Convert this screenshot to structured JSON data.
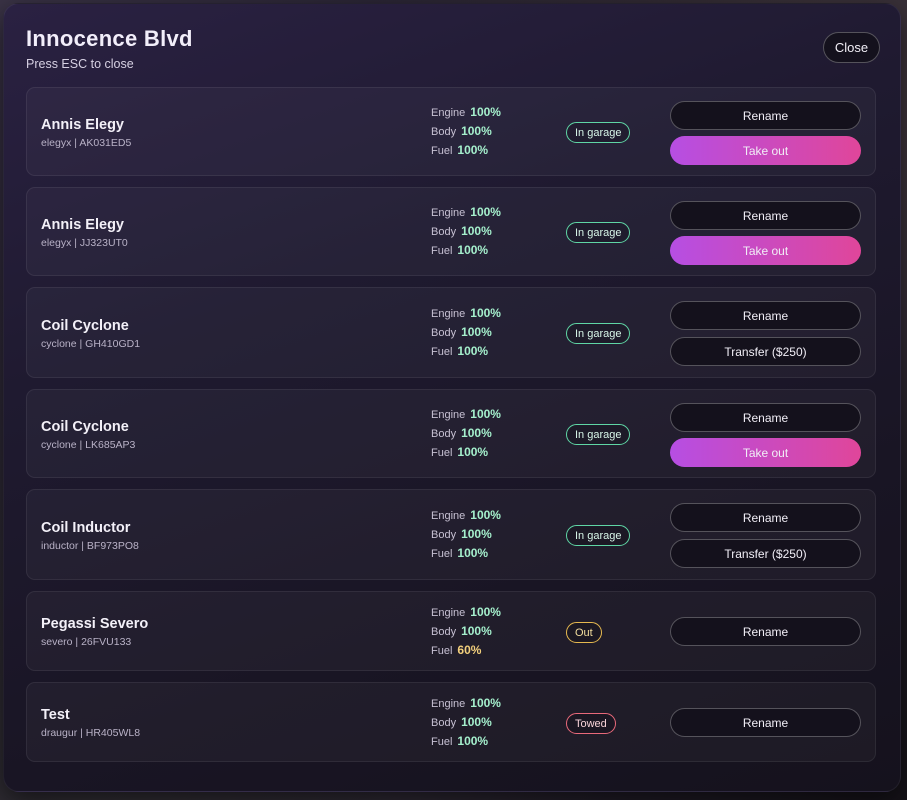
{
  "header": {
    "title": "Innocence Blvd",
    "subtitle": "Press ESC to close",
    "close_label": "Close"
  },
  "labels": {
    "engine": "Engine",
    "body": "Body",
    "fuel": "Fuel"
  },
  "vehicles": [
    {
      "name": "Annis Elegy",
      "model": "elegyx",
      "plate": "AK031ED5",
      "engine": "100%",
      "body": "100%",
      "fuel": "100%",
      "status": "In garage",
      "status_color": "#5fd6a5",
      "rename_label": "Rename",
      "action_label": "Take out"
    },
    {
      "name": "Annis Elegy",
      "model": "elegyx",
      "plate": "JJ323UT0",
      "engine": "100%",
      "body": "100%",
      "fuel": "100%",
      "status": "In garage",
      "status_color": "#5fd6a5",
      "rename_label": "Rename",
      "action_label": "Take out"
    },
    {
      "name": "Coil Cyclone",
      "model": "cyclone",
      "plate": "GH410GD1",
      "engine": "100%",
      "body": "100%",
      "fuel": "100%",
      "status": "In garage",
      "status_color": "#5fd6a5",
      "rename_label": "Rename",
      "action_label": "Transfer ($250)"
    },
    {
      "name": "Coil Cyclone",
      "model": "cyclone",
      "plate": "LK685AP3",
      "engine": "100%",
      "body": "100%",
      "fuel": "100%",
      "status": "In garage",
      "status_color": "#5fd6a5",
      "rename_label": "Rename",
      "action_label": "Take out"
    },
    {
      "name": "Coil Inductor",
      "model": "inductor",
      "plate": "BF973PO8",
      "engine": "100%",
      "body": "100%",
      "fuel": "100%",
      "status": "In garage",
      "status_color": "#5fd6a5",
      "rename_label": "Rename",
      "action_label": "Transfer ($250)"
    },
    {
      "name": "Pegassi Severo",
      "model": "severo",
      "plate": "26FVU133",
      "engine": "100%",
      "body": "100%",
      "fuel": "60%",
      "status": "Out",
      "status_color": "#e5b84f",
      "rename_label": "Rename"
    },
    {
      "name": "Test",
      "model": "draugur",
      "plate": "HR405WL8",
      "engine": "100%",
      "body": "100%",
      "fuel": "100%",
      "status": "Towed",
      "status_color": "#e8697a",
      "rename_label": "Rename"
    }
  ]
}
